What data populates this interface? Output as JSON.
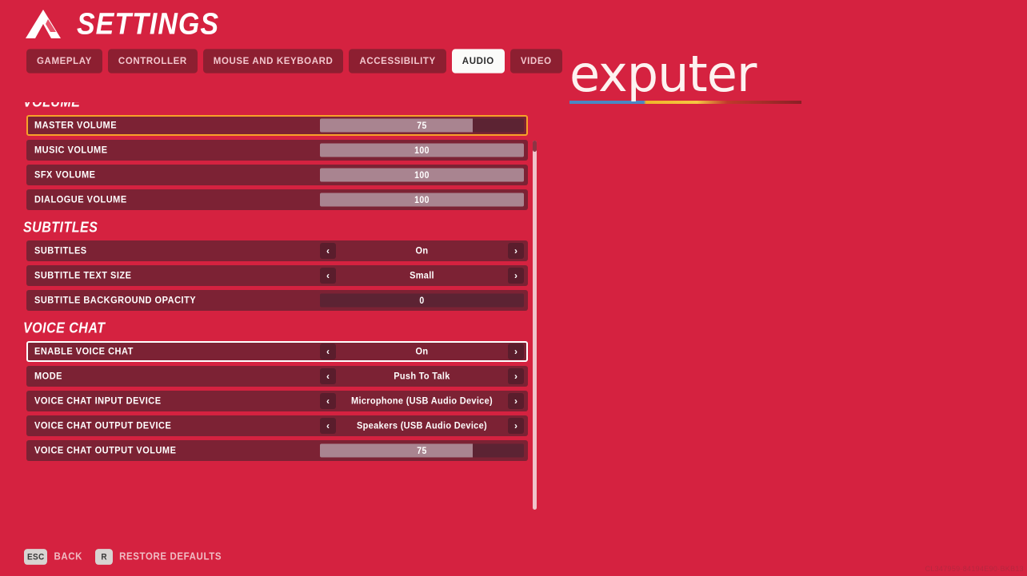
{
  "header": {
    "title": "SETTINGS",
    "logo_icon": "mountain-chevron-icon"
  },
  "tabs": [
    {
      "label": "GAMEPLAY",
      "active": false
    },
    {
      "label": "CONTROLLER",
      "active": false
    },
    {
      "label": "MOUSE AND KEYBOARD",
      "active": false
    },
    {
      "label": "ACCESSIBILITY",
      "active": false
    },
    {
      "label": "AUDIO",
      "active": true
    },
    {
      "label": "VIDEO",
      "active": false
    }
  ],
  "groups": [
    {
      "title": "VOLUME",
      "rows": [
        {
          "label": "MASTER VOLUME",
          "type": "slider",
          "value": "75",
          "percent": 75,
          "state": "selected"
        },
        {
          "label": "MUSIC VOLUME",
          "type": "slider",
          "value": "100",
          "percent": 100,
          "state": "none"
        },
        {
          "label": "SFX VOLUME",
          "type": "slider",
          "value": "100",
          "percent": 100,
          "state": "none"
        },
        {
          "label": "DIALOGUE VOLUME",
          "type": "slider",
          "value": "100",
          "percent": 100,
          "state": "none"
        }
      ]
    },
    {
      "title": "SUBTITLES",
      "rows": [
        {
          "label": "SUBTITLES",
          "type": "stepper",
          "value": "On",
          "state": "none"
        },
        {
          "label": "SUBTITLE TEXT SIZE",
          "type": "stepper",
          "value": "Small",
          "state": "none"
        },
        {
          "label": "SUBTITLE BACKGROUND OPACITY",
          "type": "slider",
          "value": "0",
          "percent": 0,
          "state": "none"
        }
      ]
    },
    {
      "title": "VOICE CHAT",
      "rows": [
        {
          "label": "ENABLE VOICE CHAT",
          "type": "stepper",
          "value": "On",
          "state": "hovered"
        },
        {
          "label": "MODE",
          "type": "stepper",
          "value": "Push To Talk",
          "state": "none"
        },
        {
          "label": "VOICE CHAT INPUT DEVICE",
          "type": "stepper",
          "value": "Microphone (USB Audio Device)",
          "state": "none"
        },
        {
          "label": "VOICE CHAT OUTPUT DEVICE",
          "type": "stepper",
          "value": "Speakers (USB Audio Device)",
          "state": "none"
        },
        {
          "label": "VOICE CHAT OUTPUT VOLUME",
          "type": "slider",
          "value": "75",
          "percent": 75,
          "state": "none"
        }
      ]
    }
  ],
  "stepper_arrows": {
    "left": "‹",
    "right": "›"
  },
  "watermark": {
    "text": "exputer"
  },
  "footer": {
    "hints": [
      {
        "key": "ESC",
        "label": "BACK"
      },
      {
        "key": "R",
        "label": "RESTORE DEFAULTS"
      }
    ]
  },
  "build_id": "CL347959·84194E90·BKB13",
  "colors": {
    "background": "#d52240",
    "row": "#7c2234",
    "selected_border": "#f7a228",
    "hovered_border": "#ffffff",
    "slider_fill": "#a98490",
    "tab_active_bg": "#fbfbf9"
  }
}
